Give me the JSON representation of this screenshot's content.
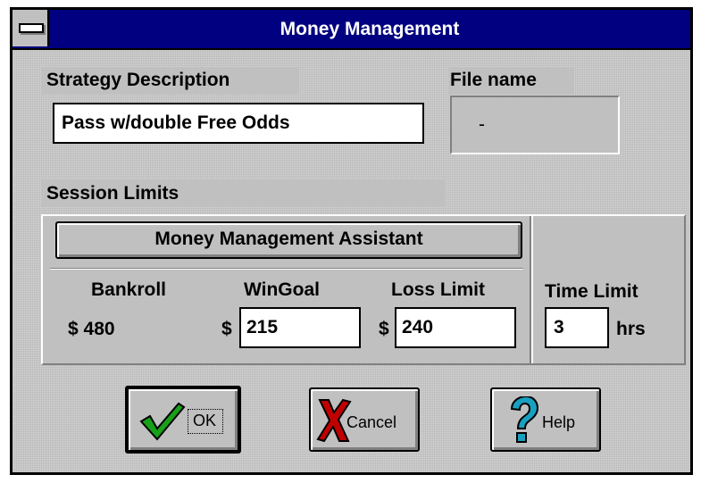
{
  "window": {
    "title": "Money Management"
  },
  "strategy": {
    "label": "Strategy Description",
    "value": "Pass w/double Free Odds"
  },
  "file": {
    "label": "File name",
    "value": "-"
  },
  "session": {
    "label": "Session Limits",
    "assistant_button": "Money Management Assistant",
    "bankroll": {
      "label": "Bankroll",
      "value": "$ 480"
    },
    "wingoal": {
      "label": "WinGoal",
      "currency": "$",
      "value": "215"
    },
    "losslimit": {
      "label": "Loss Limit",
      "currency": "$",
      "value": "240"
    },
    "timelimit": {
      "label": "Time Limit",
      "value": "3",
      "unit": "hrs"
    }
  },
  "buttons": {
    "ok": "OK",
    "cancel": "Cancel",
    "help": "Help"
  },
  "icons": {
    "ok": "checkmark-icon",
    "cancel": "red-x-icon",
    "help": "question-mark-icon"
  },
  "colors": {
    "titlebar": "#000080",
    "face": "#c0c0c0",
    "check": "#18a018",
    "cancel": "#c00000",
    "help": "#18a0c0"
  }
}
